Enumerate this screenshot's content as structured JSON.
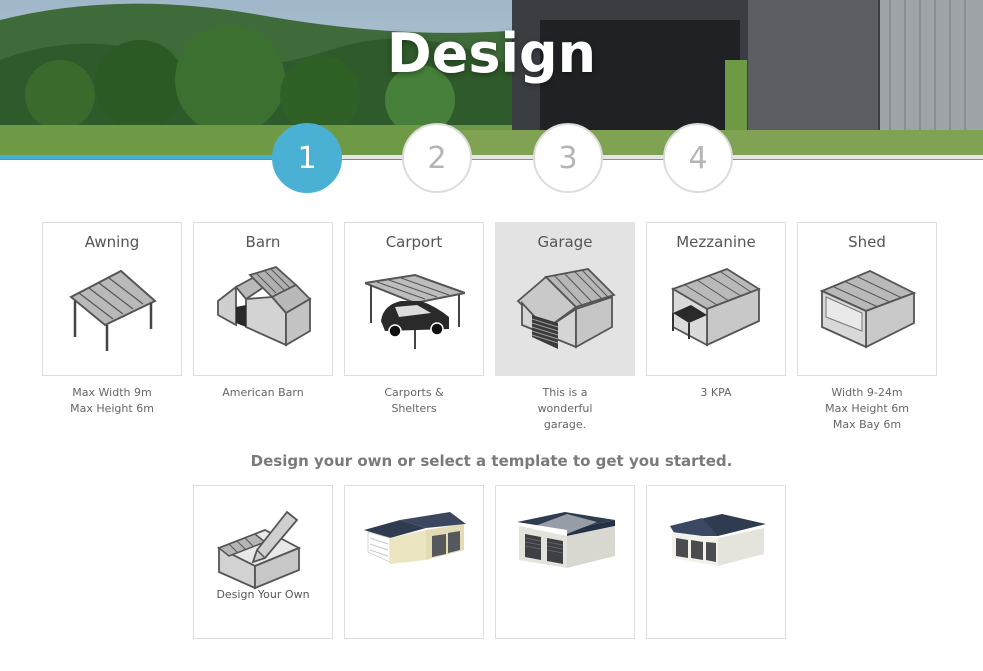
{
  "hero": {
    "title": "Design"
  },
  "steps": [
    "1",
    "2",
    "3",
    "4"
  ],
  "active_step": 1,
  "progress_fraction": 0.3,
  "categories": [
    {
      "label": "Awning",
      "desc": [
        "Max Width 9m",
        "Max Height 6m"
      ],
      "icon": "awning-icon"
    },
    {
      "label": "Barn",
      "desc": [
        "American Barn"
      ],
      "icon": "barn-icon"
    },
    {
      "label": "Carport",
      "desc": [
        "Carports &",
        "Shelters"
      ],
      "icon": "carport-icon"
    },
    {
      "label": "Garage",
      "desc": [
        "This is a",
        "wonderful",
        "garage."
      ],
      "icon": "garage-icon"
    },
    {
      "label": "Mezzanine",
      "desc": [
        "3 KPA"
      ],
      "icon": "mezzanine-icon"
    },
    {
      "label": "Shed",
      "desc": [
        "Width 9-24m",
        "Max Height 6m",
        "Max Bay 6m"
      ],
      "icon": "shed-icon"
    }
  ],
  "selected_category": "Garage",
  "prompt": "Design your own or select a template to get you started.",
  "templates": [
    {
      "label": "Design Your Own",
      "icon": "design-own-icon"
    },
    {
      "label": "",
      "icon": "template-cream-garage-icon"
    },
    {
      "label": "",
      "icon": "template-white-garage-icon"
    },
    {
      "label": "",
      "icon": "template-triple-garage-icon"
    }
  ],
  "colors": {
    "accent": "#4bb1d4",
    "selected_card": "#e3e3e3",
    "roof_dark": "#2f3b4f"
  }
}
